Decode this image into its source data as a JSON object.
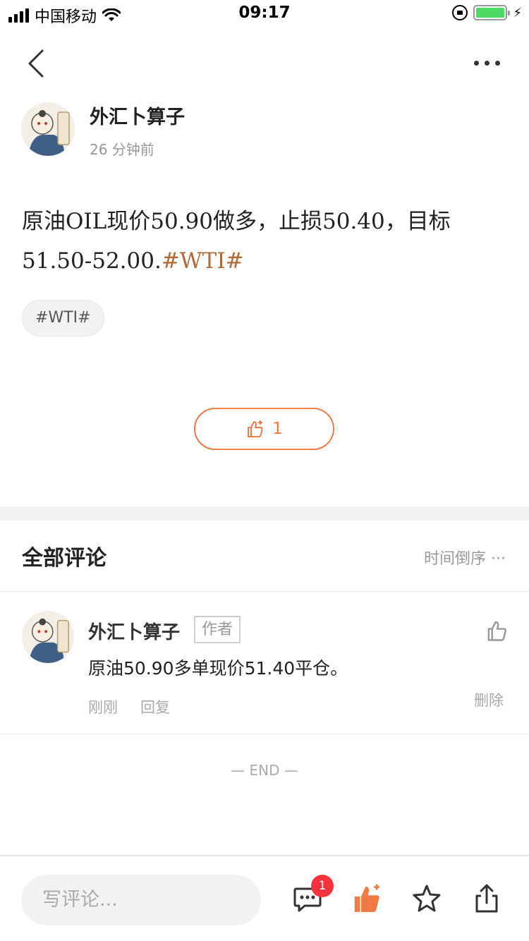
{
  "status_bar": {
    "carrier": "中国移动",
    "time": "09:17"
  },
  "post": {
    "author": "外汇卜算子",
    "time_ago": "26 分钟前",
    "text_main": "原油OIL现价50.90做多，止损50.40，目标51.50-52.00.",
    "text_hashtag": "#WTI#",
    "tag": "#WTI#",
    "like_count": "1"
  },
  "comments": {
    "title": "全部评论",
    "sort_label": "时间倒序 ···",
    "items": [
      {
        "author": "外汇卜算子",
        "author_badge": "作者",
        "text": "原油50.90多单现价51.40平仓。",
        "time": "刚刚",
        "reply_label": "回复",
        "delete_label": "删除"
      }
    ],
    "end_label": "— END —"
  },
  "bottom_bar": {
    "input_placeholder": "写评论...",
    "comment_badge": "1"
  },
  "colors": {
    "accent": "#f07a45",
    "hashtag": "#b06a3a",
    "badge_red": "#f4333c"
  }
}
